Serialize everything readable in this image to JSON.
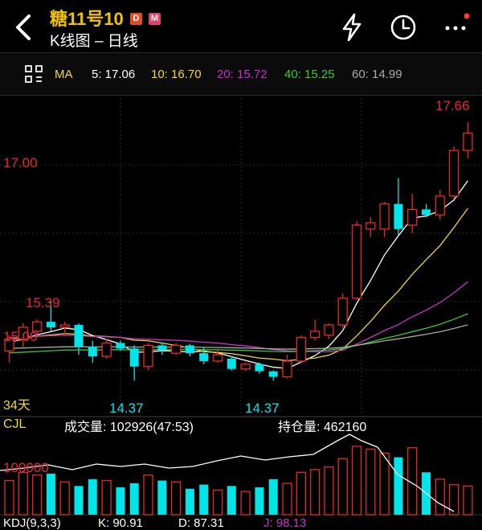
{
  "header": {
    "title": "糖11号10",
    "badge_d": "D",
    "badge_m": "M",
    "subtitle": "K线图 – 日线"
  },
  "ma_bar": {
    "label": "MA",
    "ma5": "5: 17.06",
    "ma10": "10: 16.70",
    "ma20": "20: 15.72",
    "ma40": "40: 15.25",
    "ma60": "60: 14.99"
  },
  "price_labels": {
    "high": "17.66",
    "level_1700": "17.00",
    "local_high": "15.39",
    "level_1500": "15.00",
    "low_left": "14.37",
    "low_right": "14.37",
    "days": "34天"
  },
  "volume_panel": {
    "cjl": "CJL",
    "volume_label": "成交量: 102926(47:53)",
    "oi_label": "持仓量: 462160",
    "scale": "100000"
  },
  "kdj": {
    "name": "KDJ(9,3,3)",
    "k": "K: 90.91",
    "d": "D: 87.31",
    "j": "J: 98.13"
  },
  "colors": {
    "up": "#e8272b",
    "down": "#00e5ea",
    "ma5": "#ffffff",
    "ma10": "#eedd2a",
    "ma20": "#cc2ecc",
    "ma40": "#33cc33",
    "ma60": "#aaaaaa",
    "title": "#f2c200",
    "badge_d": "#e04b2b",
    "badge_m": "#e0436b"
  },
  "chart_data": {
    "type": "candlestick",
    "y_range": [
      14.2,
      17.7
    ],
    "candles": [
      {
        "o": 14.75,
        "h": 14.95,
        "l": 14.6,
        "c": 14.9
      },
      {
        "o": 14.9,
        "h": 15.1,
        "l": 14.8,
        "c": 15.05
      },
      {
        "o": 15.0,
        "h": 15.15,
        "l": 14.95,
        "c": 15.12
      },
      {
        "o": 15.12,
        "h": 15.39,
        "l": 15.0,
        "c": 15.05
      },
      {
        "o": 15.05,
        "h": 15.12,
        "l": 14.95,
        "c": 15.08
      },
      {
        "o": 15.08,
        "h": 15.1,
        "l": 14.7,
        "c": 14.8
      },
      {
        "o": 14.8,
        "h": 14.88,
        "l": 14.6,
        "c": 14.68
      },
      {
        "o": 14.68,
        "h": 14.9,
        "l": 14.65,
        "c": 14.85
      },
      {
        "o": 14.85,
        "h": 14.88,
        "l": 14.75,
        "c": 14.78
      },
      {
        "o": 14.78,
        "h": 14.82,
        "l": 14.37,
        "c": 14.55
      },
      {
        "o": 14.55,
        "h": 14.85,
        "l": 14.5,
        "c": 14.82
      },
      {
        "o": 14.82,
        "h": 14.86,
        "l": 14.7,
        "c": 14.76
      },
      {
        "o": 14.72,
        "h": 14.85,
        "l": 14.7,
        "c": 14.82
      },
      {
        "o": 14.82,
        "h": 14.84,
        "l": 14.68,
        "c": 14.72
      },
      {
        "o": 14.72,
        "h": 14.8,
        "l": 14.58,
        "c": 14.62
      },
      {
        "o": 14.62,
        "h": 14.78,
        "l": 14.6,
        "c": 14.7
      },
      {
        "o": 14.65,
        "h": 14.68,
        "l": 14.5,
        "c": 14.52
      },
      {
        "o": 14.52,
        "h": 14.6,
        "l": 14.5,
        "c": 14.58
      },
      {
        "o": 14.58,
        "h": 14.6,
        "l": 14.46,
        "c": 14.49
      },
      {
        "o": 14.49,
        "h": 14.5,
        "l": 14.37,
        "c": 14.42
      },
      {
        "o": 14.42,
        "h": 14.7,
        "l": 14.4,
        "c": 14.62
      },
      {
        "o": 14.62,
        "h": 14.95,
        "l": 14.6,
        "c": 14.92
      },
      {
        "o": 14.92,
        "h": 15.15,
        "l": 14.88,
        "c": 15.0
      },
      {
        "o": 14.95,
        "h": 15.1,
        "l": 14.9,
        "c": 15.08
      },
      {
        "o": 15.08,
        "h": 15.48,
        "l": 15.05,
        "c": 15.42
      },
      {
        "o": 15.42,
        "h": 16.4,
        "l": 15.4,
        "c": 16.35
      },
      {
        "o": 16.3,
        "h": 16.45,
        "l": 16.2,
        "c": 16.38
      },
      {
        "o": 16.3,
        "h": 16.65,
        "l": 16.2,
        "c": 16.62
      },
      {
        "o": 16.62,
        "h": 16.95,
        "l": 16.22,
        "c": 16.3
      },
      {
        "o": 16.35,
        "h": 16.75,
        "l": 16.25,
        "c": 16.55
      },
      {
        "o": 16.55,
        "h": 16.62,
        "l": 16.45,
        "c": 16.48
      },
      {
        "o": 16.48,
        "h": 16.8,
        "l": 16.42,
        "c": 16.72
      },
      {
        "o": 16.72,
        "h": 17.35,
        "l": 16.68,
        "c": 17.3
      },
      {
        "o": 17.3,
        "h": 17.66,
        "l": 17.2,
        "c": 17.52
      }
    ],
    "volume_bars": [
      0.5,
      0.62,
      0.58,
      0.6,
      0.48,
      0.42,
      0.52,
      0.5,
      0.4,
      0.46,
      0.58,
      0.5,
      0.48,
      0.38,
      0.44,
      0.36,
      0.42,
      0.34,
      0.4,
      0.52,
      0.46,
      0.62,
      0.66,
      0.7,
      0.82,
      1.0,
      0.96,
      0.9,
      0.84,
      0.98,
      0.62,
      0.52,
      0.44,
      0.42
    ]
  }
}
